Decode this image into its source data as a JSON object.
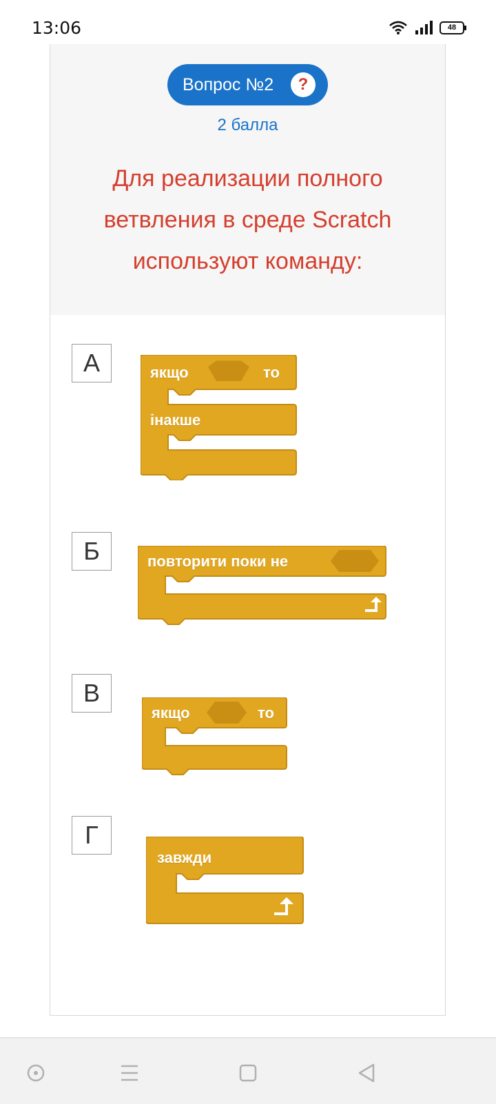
{
  "status": {
    "time": "13:06",
    "battery": "48"
  },
  "question": {
    "badge": "Вопрос №2",
    "help": "?",
    "points": "2 балла",
    "text": "Для реализации полного ветвления в среде Scratch используют команду:"
  },
  "options": [
    {
      "letter": "А",
      "block_labels": [
        "якщо",
        "то",
        "інакше"
      ]
    },
    {
      "letter": "Б",
      "block_labels": [
        "повторити поки  не"
      ]
    },
    {
      "letter": "В",
      "block_labels": [
        "якщо",
        "то"
      ]
    },
    {
      "letter": "Г",
      "block_labels": [
        "завжди"
      ]
    }
  ],
  "colors": {
    "accent": "#1a73c8",
    "question": "#d43f2e",
    "block": "#e2a720",
    "block_border": "#c48b14"
  },
  "nav": {
    "icons": [
      "circle-dot-icon",
      "menu-icon",
      "square-icon",
      "back-triangle-icon"
    ]
  }
}
